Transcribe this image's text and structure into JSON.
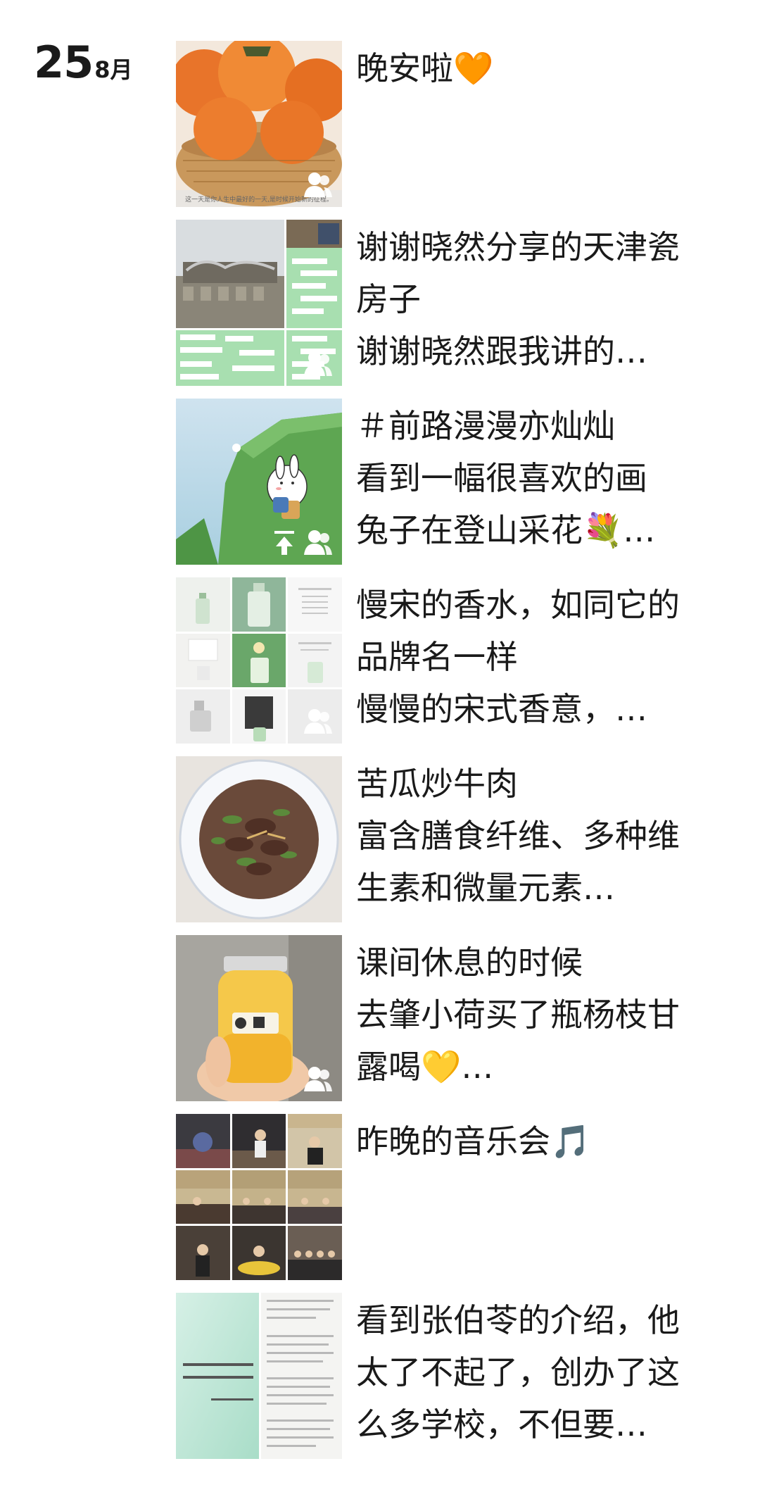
{
  "date": {
    "day": "25",
    "month": "8月"
  },
  "posts": [
    {
      "lines": [
        "晚安啦🧡"
      ],
      "caption": "这一天是你人生中最好的一天,是时候开始新的征程。",
      "icons": [
        "friends-only-icon"
      ]
    },
    {
      "lines": [
        "谢谢晓然分享的天津瓷",
        "房子",
        "谢谢晓然跟我讲的…"
      ],
      "icons": [
        "friends-only-icon"
      ]
    },
    {
      "lines": [
        "＃前路漫漫亦灿灿",
        "看到一幅很喜欢的画",
        "兔子在登山采花💐…"
      ],
      "icons": [
        "upload-icon",
        "friends-only-icon"
      ]
    },
    {
      "lines": [
        "慢宋的香水，如同它的",
        "品牌名一样",
        "慢慢的宋式香意，…"
      ],
      "icons": [
        "friends-only-icon"
      ]
    },
    {
      "lines": [
        "苦瓜炒牛肉",
        "富含膳食纤维、多种维",
        "生素和微量元素…"
      ],
      "icons": []
    },
    {
      "lines": [
        "课间休息的时候",
        "去肇小荷买了瓶杨枝甘",
        "露喝💛…"
      ],
      "icons": [
        "friends-only-icon"
      ]
    },
    {
      "lines": [
        "昨晚的音乐会🎵"
      ],
      "icons": []
    },
    {
      "lines": [
        "看到张伯苓的介绍，他",
        "太了不起了，创办了这",
        "么多学校，不但要…"
      ],
      "icons": []
    }
  ],
  "colors": {
    "text": "#1a1a1a",
    "background": "#ffffff"
  }
}
